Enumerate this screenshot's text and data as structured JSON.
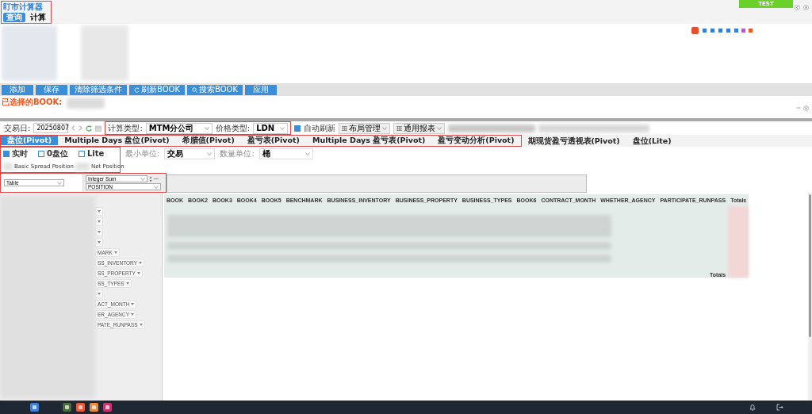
{
  "app": {
    "title": "盯市计算器",
    "tabs": [
      {
        "label": "查询",
        "selected": true
      },
      {
        "label": "计算",
        "selected": false
      }
    ],
    "test_button": "TEST"
  },
  "book_panel": {
    "buttons": [
      {
        "label": "添加",
        "kind": "plain"
      },
      {
        "label": "保存",
        "kind": "plain"
      },
      {
        "label": "清除筛选条件",
        "kind": "plain"
      },
      {
        "label": "刷新BOOK",
        "kind": "refresh"
      },
      {
        "label": "搜索BOOK",
        "kind": "search"
      },
      {
        "label": "应用",
        "kind": "plain"
      }
    ],
    "selected_label": "已选择的BOOK:"
  },
  "toolbar": {
    "trade_date_label": "交易日:",
    "trade_date": "20250807",
    "calc_type_label": "计算类型:",
    "calc_type": "MTM分公司",
    "price_type_label": "价格类型:",
    "price_type": "LDN",
    "auto_refresh": {
      "label": "自动刷新",
      "checked": true
    },
    "menus": [
      "布局管理",
      "通用报表"
    ]
  },
  "report_tabs": [
    {
      "label": "盘位(Pivot)",
      "selected": true
    },
    {
      "label": "Multiple Days 盘位(Pivot)",
      "selected": false
    },
    {
      "label": "希腊值(Pivot)",
      "selected": false
    },
    {
      "label": "盈亏表(Pivot)",
      "selected": false
    },
    {
      "label": "Multiple Days 盈亏表(Pivot)",
      "selected": false
    },
    {
      "label": "盈亏变动分析(Pivot)",
      "selected": false
    },
    {
      "label": "期现货盈亏透视表(Pivot)",
      "selected": false
    },
    {
      "label": "盘位(Lite)",
      "selected": false
    }
  ],
  "options": {
    "checkboxes": [
      {
        "label": "实时",
        "checked": true
      },
      {
        "label": "0盘位",
        "checked": false
      },
      {
        "label": "Lite",
        "checked": false
      }
    ],
    "min_unit_label": "最小单位:",
    "min_unit": "交易",
    "qty_unit_label": "数量单位:",
    "qty_unit": "桶",
    "views": [
      "Basic Spread Position",
      "Net Position"
    ]
  },
  "pivot": {
    "renderer": "Table",
    "aggregator": "Integer Sum",
    "value_field": "POSITION",
    "fields": [
      {
        "kind": "hidden"
      },
      {
        "kind": "hidden"
      },
      {
        "kind": "hidden"
      },
      {
        "kind": "hidden"
      },
      {
        "kind": "named",
        "label": "MARK"
      },
      {
        "kind": "named",
        "label": "SS_INVENTORY"
      },
      {
        "kind": "named",
        "label": "SS_PROPERTY"
      },
      {
        "kind": "named",
        "label": "SS_TYPES"
      },
      {
        "kind": "hidden"
      },
      {
        "kind": "named",
        "label": "ACT_MONTH"
      },
      {
        "kind": "named",
        "label": "ER_AGENCY"
      },
      {
        "kind": "named",
        "label": "PATE_RUNPASS"
      }
    ],
    "columns": [
      "BOOK",
      "BOOK2",
      "BOOK3",
      "BOOK4",
      "BOOK5",
      "BENCHMARK",
      "BUSINESS_INVENTORY",
      "BUSINESS_PROPERTY",
      "BUSINESS_TYPES",
      "BOOK6",
      "CONTRACT_MONTH",
      "WHETHER_AGENCY",
      "PARTICIPATE_RUNPASS",
      "Totals"
    ],
    "totals_label": "Totals"
  }
}
